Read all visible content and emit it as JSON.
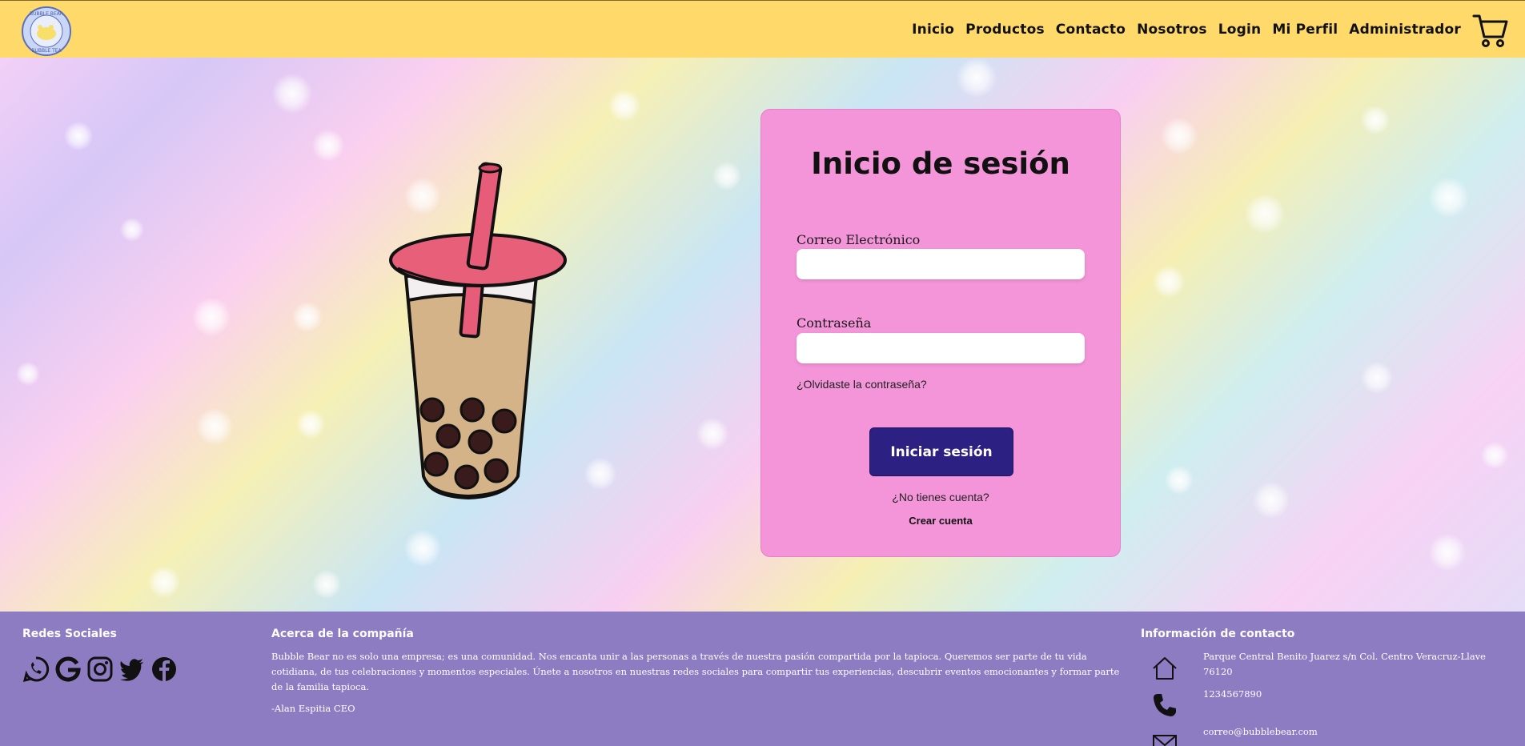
{
  "header": {
    "logo_text": "BUBBLE BEAR BUBBLE TEA",
    "nav": [
      "Inicio",
      "Productos",
      "Contacto",
      "Nosotros",
      "Login",
      "Mi Perfil",
      "Administrador"
    ],
    "cart_icon": "shopping-cart-icon",
    "background": "#ffd96a"
  },
  "login": {
    "title": "Inicio de sesión",
    "email_label": "Correo Electrónico",
    "email_value": "",
    "password_label": "Contraseña",
    "password_value": "",
    "forgot": "¿Olvidaste la contraseña?",
    "submit": "Iniciar sesión",
    "no_account": "¿No tienes cuenta?",
    "create_account": "Crear cuenta",
    "card_color": "#f595d9",
    "button_color": "#2c2182"
  },
  "footer": {
    "background": "#8e7cc3",
    "social_heading": "Redes Sociales",
    "social_icons": [
      "whatsapp-icon",
      "google-icon",
      "instagram-icon",
      "twitter-icon",
      "facebook-icon"
    ],
    "about_heading": "Acerca de la compañía",
    "about_text": "Bubble Bear no es solo una empresa; es una comunidad. Nos encanta unir a las personas a través de nuestra pasión compartida por la tapioca. Queremos ser parte de tu vida cotidiana, de tus celebraciones y momentos especiales. Únete a nosotros en nuestras redes sociales para compartir tus experiencias, descubrir eventos emocionantes y formar parte de la familia tapioca.",
    "about_signature": "-Alan Espitia CEO",
    "contact_heading": "Información de contacto",
    "address": "Parque Central Benito Juarez s/n Col. Centro Veracruz-Llave 76120",
    "phone": "1234567890",
    "email": "correo@bubblebear.com"
  }
}
